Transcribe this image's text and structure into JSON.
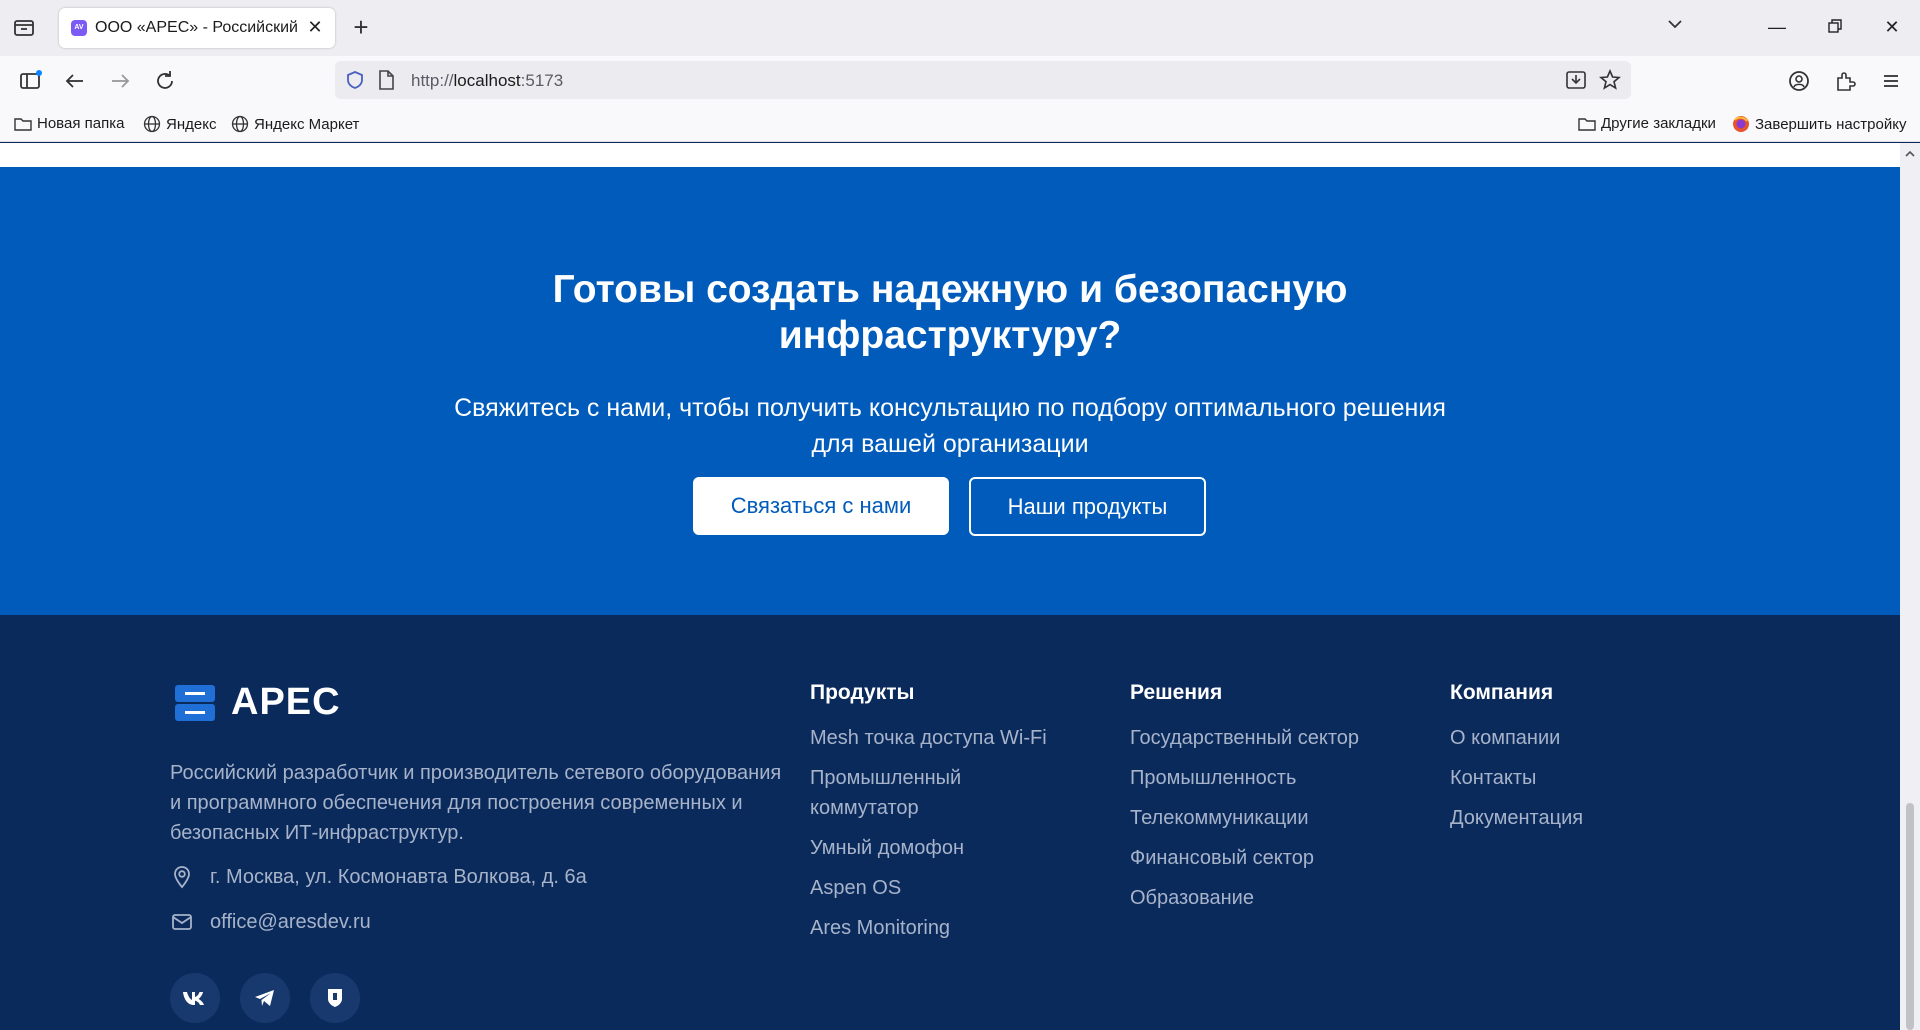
{
  "browser": {
    "tab_title": "ООО «АРЕС» - Российский разработчик",
    "favicon_text": "AV",
    "url_prefix": "http://",
    "url_host": "localhost",
    "url_port": ":5173",
    "bookmarks": {
      "new_folder": "Новая папка",
      "yandex": "Яндекс",
      "yandex_market": "Яндекс Маркет",
      "other": "Другие закладки",
      "finish_setup": "Завершить настройку"
    }
  },
  "cta": {
    "title": "Готовы создать надежную и безопасную инфраструктуру?",
    "subtitle": "Свяжитесь с нами, чтобы получить консультацию по подбору оптимального решения для вашей организации",
    "primary_button": "Связаться с нами",
    "secondary_button": "Наши продукты"
  },
  "footer": {
    "logo_text": "АРЕС",
    "description": "Российский разработчик и производитель сетевого оборудования и программного обеспечения для построения современных и безопасных ИТ-инфраструктур.",
    "address": "г. Москва, ул. Космонавта Волкова, д. 6а",
    "email": "office@aresdev.ru",
    "columns": [
      {
        "title": "Продукты",
        "links": [
          "Mesh точка доступа Wi-Fi",
          "Промышленный коммутатор",
          "Умный домофон",
          "Aspen OS",
          "Ares Monitoring"
        ]
      },
      {
        "title": "Решения",
        "links": [
          "Государственный сектор",
          "Промышленность",
          "Телекоммуникации",
          "Финансовый сектор",
          "Образование"
        ]
      },
      {
        "title": "Компания",
        "links": [
          "О компании",
          "Контакты",
          "Документация"
        ]
      }
    ]
  },
  "colors": {
    "cta_bg": "#005bbb",
    "footer_bg": "#0a2a5c",
    "footer_text": "#a7b3c9"
  }
}
